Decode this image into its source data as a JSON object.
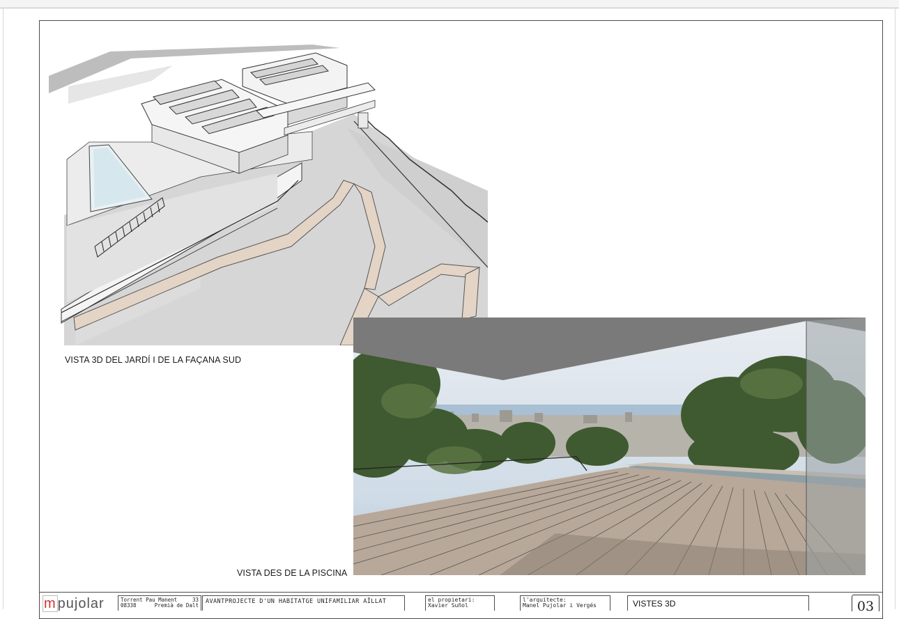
{
  "captions": {
    "garden_view": "VISTA 3D DEL JARDÍ I DE LA FAÇANA SUD",
    "pool_view": "VISTA DES DE LA PISCINA"
  },
  "title_block": {
    "logo_mark": "m",
    "logo_text": "pujolar",
    "address_line1_left": "Torrent Pau Manent",
    "address_line1_right": "33",
    "address_line2_left": "08338",
    "address_line2_right": "Premià de Dalt",
    "project": "AVANTPROJECTE D'UN HABITATGE UNIFAMILIAR AÏLLAT",
    "owner_label": "el propietari:",
    "owner_name": "Xavier Suñol",
    "architect_label": "l'arquitecte:",
    "architect_name": "Manel Pujolar i Vergés",
    "sheet_title": "VISTES 3D",
    "sheet_number": "03"
  },
  "colors": {
    "logo_accent": "#d03232",
    "path_beige": "#e4d4c6",
    "deck": "#b8a89a",
    "canopy": "#7a7a7a",
    "sky": "#dfe6ee",
    "tree_green": "#3f5a30"
  }
}
